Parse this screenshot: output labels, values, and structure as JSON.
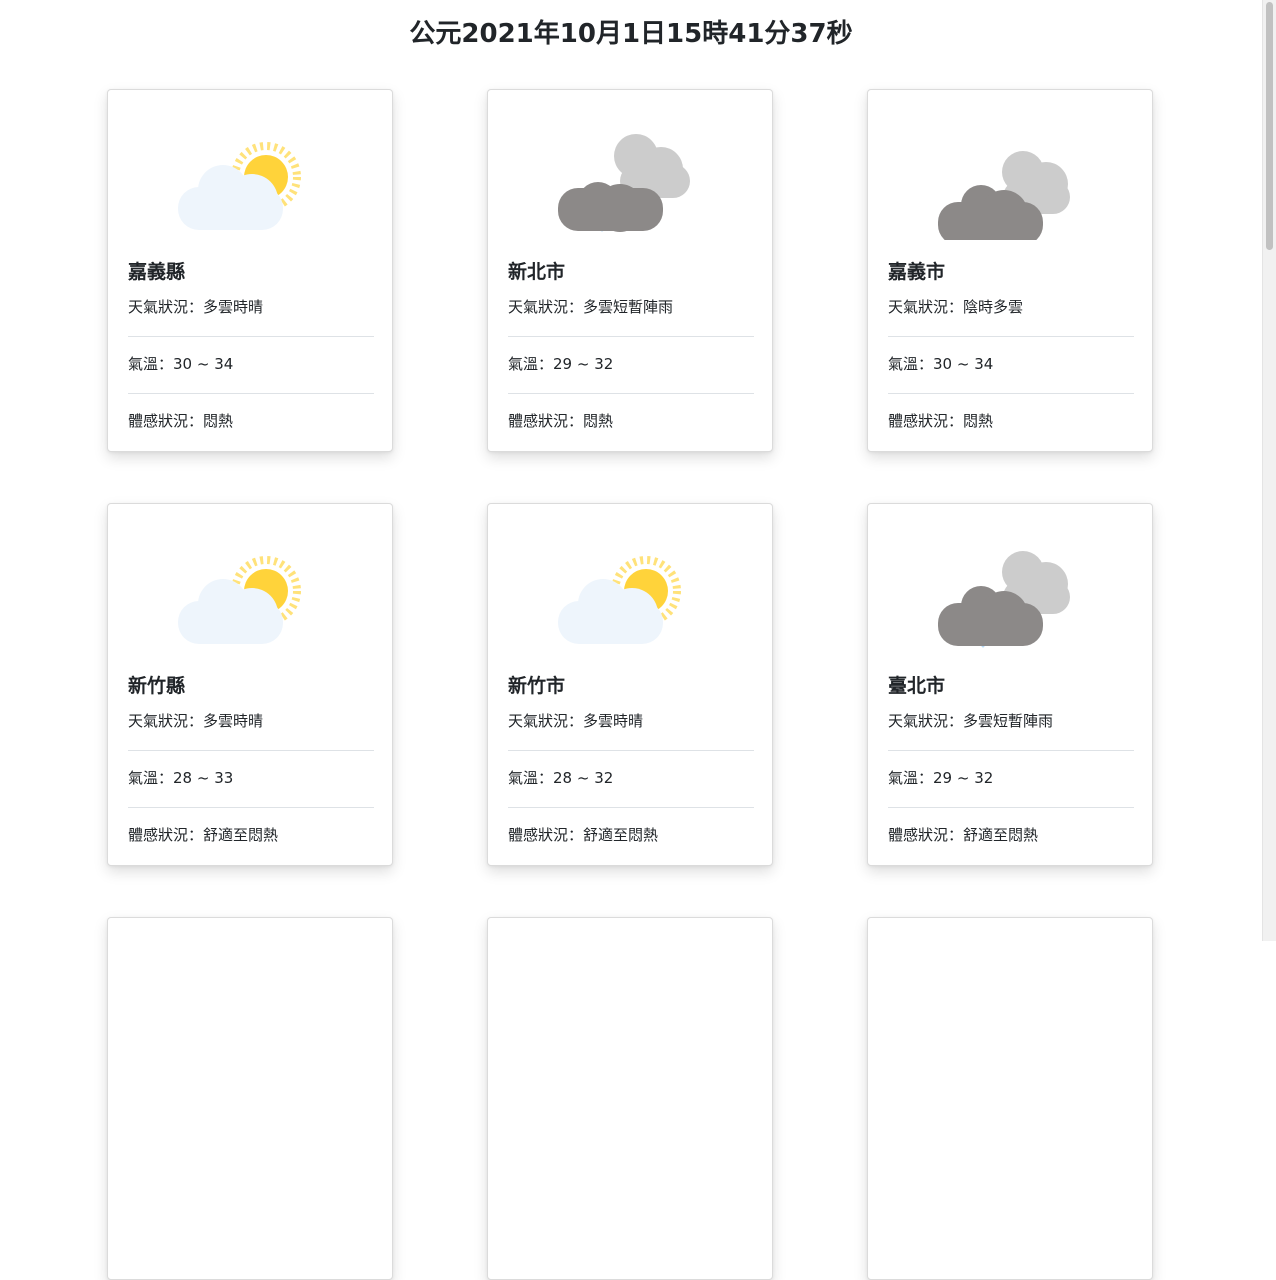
{
  "header": {
    "title": "公元2021年10月1日15時41分37秒"
  },
  "labels": {
    "weather": "天氣狀況：",
    "temp": "氣溫：",
    "comfort": "體感狀況："
  },
  "cards": [
    {
      "city": "嘉義縣",
      "weather": "多雲時晴",
      "temp": "30 ~ 34",
      "comfort": "悶熱",
      "icon": "sun-behind-cloud-icon"
    },
    {
      "city": "新北市",
      "weather": "多雲短暫陣雨",
      "temp": "29 ~ 32",
      "comfort": "悶熱",
      "icon": "rain-cloud-icon"
    },
    {
      "city": "嘉義市",
      "weather": "陰時多雲",
      "temp": "30 ~ 34",
      "comfort": "悶熱",
      "icon": "overcast-cloud-icon"
    },
    {
      "city": "新竹縣",
      "weather": "多雲時晴",
      "temp": "28 ~ 33",
      "comfort": "舒適至悶熱",
      "icon": "sun-behind-cloud-icon"
    },
    {
      "city": "新竹市",
      "weather": "多雲時晴",
      "temp": "28 ~ 32",
      "comfort": "舒適至悶熱",
      "icon": "sun-behind-cloud-icon"
    },
    {
      "city": "臺北市",
      "weather": "多雲短暫陣雨",
      "temp": "29 ~ 32",
      "comfort": "舒適至悶熱",
      "icon": "rain-cloud-icon"
    }
  ],
  "colors": {
    "sun": "#FFD33A",
    "sun_rays": "#FFE27A",
    "light_cloud": "#EEF5FC",
    "dark_cloud": "#8C8988",
    "grey_cloud": "#CCCCCC",
    "rain": "#B3D9F7"
  }
}
